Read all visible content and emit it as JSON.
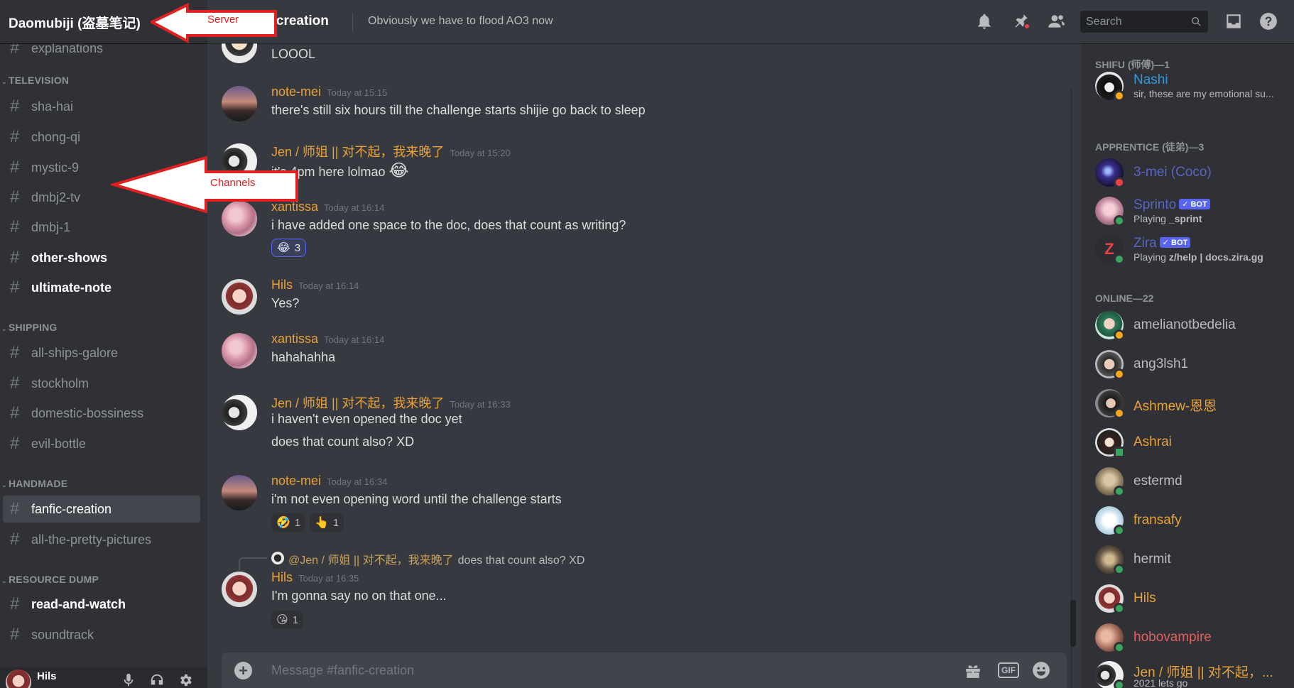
{
  "server": {
    "name": "Daomubiji (盗墓笔记)"
  },
  "header": {
    "channel_name": "c-creation",
    "topic": "Obviously we have to flood AO3 now",
    "search_placeholder": "Search",
    "icons": [
      "bell-icon",
      "pin-icon",
      "members-icon",
      "inbox-icon",
      "help-icon"
    ]
  },
  "annotations": {
    "server_label": "Server",
    "channels_label": "Channels",
    "color": "#e02020"
  },
  "sidebar": {
    "partial_top": "explanations",
    "categories": [
      {
        "name": "TELEVISION",
        "channels": [
          {
            "name": "sha-hai",
            "state": "read"
          },
          {
            "name": "chong-qi",
            "state": "read"
          },
          {
            "name": "mystic-9",
            "state": "read"
          },
          {
            "name": "dmbj2-tv",
            "state": "read"
          },
          {
            "name": "dmbj-1",
            "state": "read"
          },
          {
            "name": "other-shows",
            "state": "unread"
          },
          {
            "name": "ultimate-note",
            "state": "unread"
          }
        ]
      },
      {
        "name": "SHIPPING",
        "channels": [
          {
            "name": "all-ships-galore",
            "state": "read"
          },
          {
            "name": "stockholm",
            "state": "read"
          },
          {
            "name": "domestic-bossiness",
            "state": "read"
          },
          {
            "name": "evil-bottle",
            "state": "read"
          }
        ]
      },
      {
        "name": "HANDMADE",
        "channels": [
          {
            "name": "fanfic-creation",
            "state": "selected"
          },
          {
            "name": "all-the-pretty-pictures",
            "state": "read"
          }
        ]
      },
      {
        "name": "RESOURCE DUMP",
        "channels": [
          {
            "name": "read-and-watch",
            "state": "unread"
          },
          {
            "name": "soundtrack",
            "state": "read"
          }
        ]
      }
    ],
    "user": {
      "name": "Hils"
    }
  },
  "messages": [
    {
      "kind": "continuation",
      "text": "LOOOL"
    },
    {
      "author": "note-mei",
      "author_color": "#e8a23a",
      "timestamp": "Today at 15:15",
      "lines": [
        "there's still six hours till the challenge starts shijie go back to sleep"
      ]
    },
    {
      "author": "Jen / 师姐 || 对不起，我来晚了",
      "author_color": "#e8a23a",
      "timestamp": "Today at 15:20",
      "lines": [
        "it's 4pm here lolmao"
      ],
      "inline_emoji": "😂"
    },
    {
      "author": "xantissa",
      "author_color": "#e8a23a",
      "timestamp": "Today at 16:14",
      "lines": [
        "i have added one space to the doc, does that count as writing?"
      ],
      "reactions": [
        {
          "emoji": "😂",
          "count": "3",
          "me": true
        }
      ]
    },
    {
      "author": "Hils",
      "author_color": "#e8a23a",
      "timestamp": "Today at 16:14",
      "lines": [
        "Yes?"
      ]
    },
    {
      "author": "xantissa",
      "author_color": "#e8a23a",
      "timestamp": "Today at 16:14",
      "lines": [
        "hahahahha"
      ]
    },
    {
      "author": "Jen / 师姐 || 对不起，我来晚了",
      "author_color": "#e8a23a",
      "timestamp": "Today at 16:33",
      "lines": [
        "i haven't even opened the doc yet",
        "does that count also? XD"
      ]
    },
    {
      "author": "note-mei",
      "author_color": "#e8a23a",
      "timestamp": "Today at 16:34",
      "lines": [
        "i'm not even opening word until the challenge starts"
      ],
      "reactions": [
        {
          "emoji": "🤣",
          "count": "1",
          "me": false
        },
        {
          "emoji": "👆",
          "count": "1",
          "me": false
        }
      ]
    },
    {
      "author": "Hils",
      "author_color": "#e8a23a",
      "timestamp": "Today at 16:35",
      "lines": [
        "I'm gonna say no on that one..."
      ],
      "reply": {
        "mention": "@Jen / 师姐 || 对不起，我来晚了",
        "text": "does that count also? XD"
      },
      "reactions": [
        {
          "emoji": "😘",
          "count": "1",
          "me": false
        }
      ]
    }
  ],
  "composer": {
    "placeholder": "Message #fanfic-creation"
  },
  "members": {
    "groups": [
      {
        "title": "SHIFU (师傅)—1",
        "members": [
          {
            "name": "Nashi",
            "color": "#3498db",
            "status": "idle",
            "sub": "sir, these are my emotional su..."
          }
        ]
      },
      {
        "title": "APPRENTICE (徒弟)—3",
        "members": [
          {
            "name": "3-mei (Coco)",
            "color": "#5865c2",
            "status": "dnd",
            "sub": ""
          },
          {
            "name": "Sprinto",
            "color": "#5865c2",
            "status": "online",
            "bot": "BOT",
            "sub_prefix": "Playing ",
            "sub_bold": "_sprint"
          },
          {
            "name": "Zira",
            "color": "#5865c2",
            "status": "online",
            "bot": "BOT",
            "sub_prefix": "Playing ",
            "sub_bold": "z/help | docs.zira.gg"
          }
        ]
      },
      {
        "title": "ONLINE—22",
        "members": [
          {
            "name": "amelianotbedelia",
            "color": "#b9bbbe",
            "status": "idle"
          },
          {
            "name": "ang3lsh1",
            "color": "#b9bbbe",
            "status": "idle"
          },
          {
            "name": "Ashmew-恩恩",
            "color": "#e8a23a",
            "status": "idle"
          },
          {
            "name": "Ashrai",
            "color": "#e8a23a",
            "status": "mobile"
          },
          {
            "name": "estermd",
            "color": "#b9bbbe",
            "status": "online"
          },
          {
            "name": "fransafy",
            "color": "#e8a23a",
            "status": "online"
          },
          {
            "name": "hermit",
            "color": "#b9bbbe",
            "status": "online"
          },
          {
            "name": "Hils",
            "color": "#e8a23a",
            "status": "online"
          },
          {
            "name": "hobovampire",
            "color": "#e06060",
            "status": "online"
          },
          {
            "name": "Jen / 师姐 || 对不起，...",
            "color": "#e8a23a",
            "status": "online",
            "sub": "2021 lets go"
          }
        ]
      }
    ]
  },
  "colors": {
    "online": "#3ba55d",
    "idle": "#faa81a",
    "dnd": "#ed4245",
    "accent": "#5865f2"
  }
}
